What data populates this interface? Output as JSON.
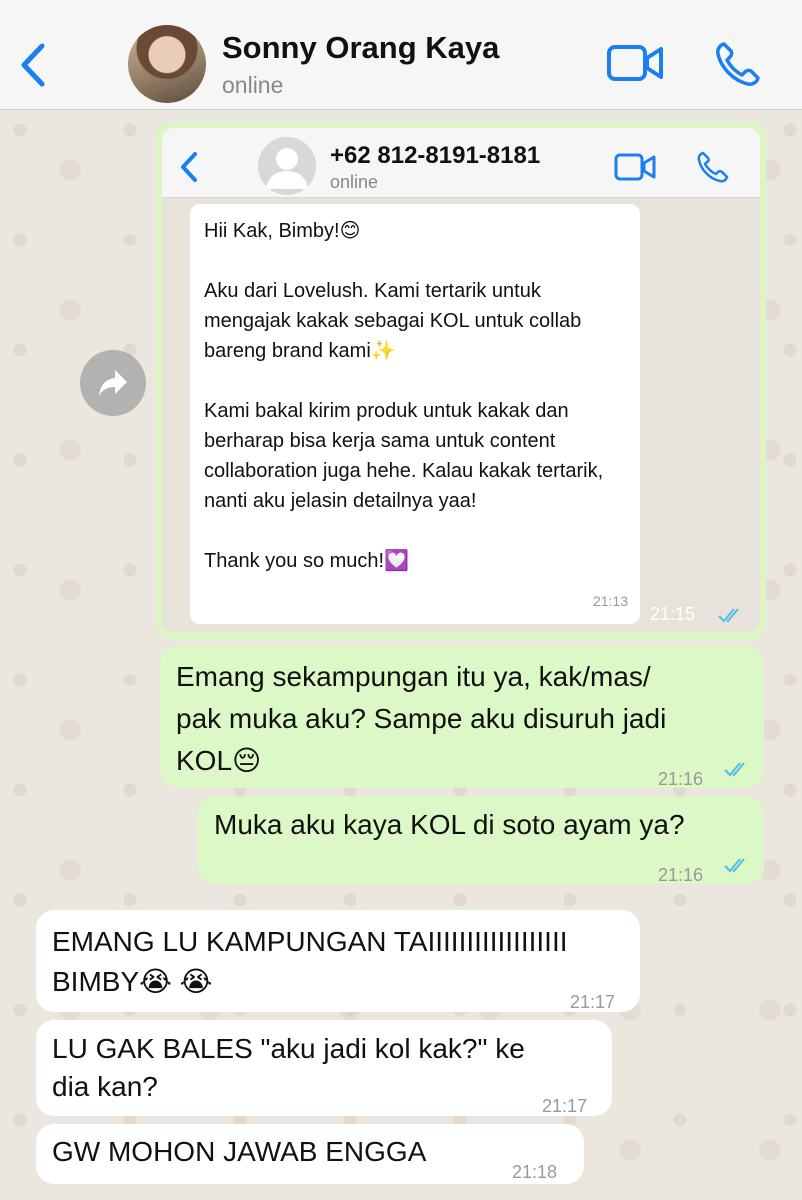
{
  "header": {
    "contact_name": "Sonny Orang Kaya",
    "status": "online"
  },
  "forwarded": {
    "contact": "+62 812-8191-8181",
    "status": "online",
    "message": "Hii Kak, Bimby!😊\n\nAku dari Lovelush. Kami tertarik untuk mengajak kakak sebagai KOL untuk collab bareng brand kami✨\n\nKami bakal kirim produk untuk kakak dan berharap bisa kerja sama untuk content collaboration juga hehe. Kalau kakak tertarik, nanti aku jelasin detailnya yaa!\n\nThank you so much!💟",
    "inner_time": "21:13",
    "time": "21:15"
  },
  "messages": [
    {
      "text": "Emang sekampungan itu ya, kak/mas/\npak muka aku? Sampe aku disuruh jadi\nKOL😔",
      "time": "21:16"
    },
    {
      "text": "Muka aku kaya KOL di soto ayam ya?",
      "time": "21:16"
    },
    {
      "text": "EMANG LU KAMPUNGAN TAIIIIIIIIIIIIIIIIII\nBIMBY😭 😭",
      "time": "21:17"
    },
    {
      "text": "LU GAK BALES \"aku jadi kol kak?\" ke\ndia kan?",
      "time": "21:17"
    },
    {
      "text": "GW MOHON JAWAB ENGGA",
      "time": "21:18"
    }
  ],
  "colors": {
    "accent": "#1a7ff0",
    "outgoing": "#dcf8c6",
    "incoming": "#ffffff",
    "ticks": "#53bdeb"
  }
}
